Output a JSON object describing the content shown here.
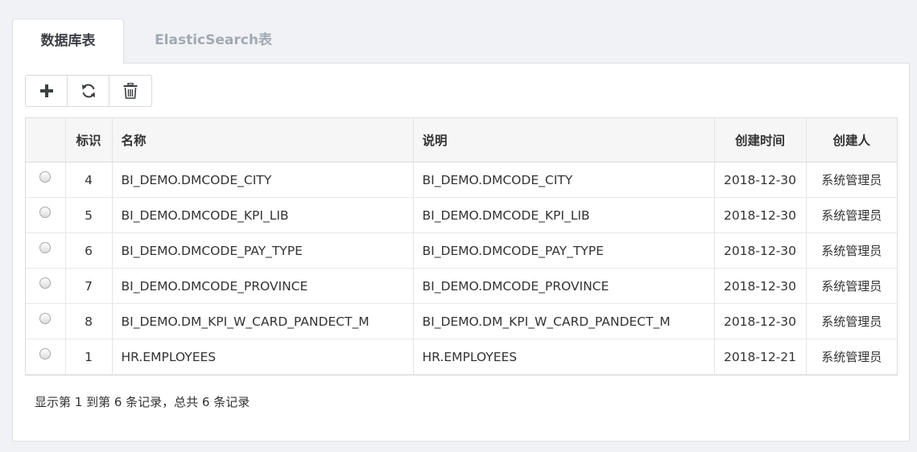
{
  "tabs": [
    {
      "label": "数据库表",
      "active": true
    },
    {
      "label": "ElasticSearch表",
      "active": false
    }
  ],
  "toolbar": {
    "buttons": [
      {
        "icon": "plus-icon"
      },
      {
        "icon": "refresh-icon"
      },
      {
        "icon": "trash-icon"
      }
    ]
  },
  "table": {
    "headers": {
      "select": "",
      "id": "标识",
      "name": "名称",
      "description": "说明",
      "created_time": "创建时间",
      "creator": "创建人"
    },
    "rows": [
      {
        "id": "4",
        "name": "BI_DEMO.DMCODE_CITY",
        "description": "BI_DEMO.DMCODE_CITY",
        "created_time": "2018-12-30",
        "creator": "系统管理员"
      },
      {
        "id": "5",
        "name": "BI_DEMO.DMCODE_KPI_LIB",
        "description": "BI_DEMO.DMCODE_KPI_LIB",
        "created_time": "2018-12-30",
        "creator": "系统管理员"
      },
      {
        "id": "6",
        "name": "BI_DEMO.DMCODE_PAY_TYPE",
        "description": "BI_DEMO.DMCODE_PAY_TYPE",
        "created_time": "2018-12-30",
        "creator": "系统管理员"
      },
      {
        "id": "7",
        "name": "BI_DEMO.DMCODE_PROVINCE",
        "description": "BI_DEMO.DMCODE_PROVINCE",
        "created_time": "2018-12-30",
        "creator": "系统管理员"
      },
      {
        "id": "8",
        "name": "BI_DEMO.DM_KPI_W_CARD_PANDECT_M",
        "description": "BI_DEMO.DM_KPI_W_CARD_PANDECT_M",
        "created_time": "2018-12-30",
        "creator": "系统管理员"
      },
      {
        "id": "1",
        "name": "HR.EMPLOYEES",
        "description": "HR.EMPLOYEES",
        "created_time": "2018-12-21",
        "creator": "系统管理员"
      }
    ]
  },
  "pagination": {
    "summary": "显示第 1 到第 6 条记录，总共 6 条记录"
  },
  "colors": {
    "background": "#f0f2f5",
    "panel": "#ffffff",
    "border": "#dcdfe6",
    "inactive_tab_text": "#a3a9b4",
    "header_bg": "#f6f6f6"
  }
}
